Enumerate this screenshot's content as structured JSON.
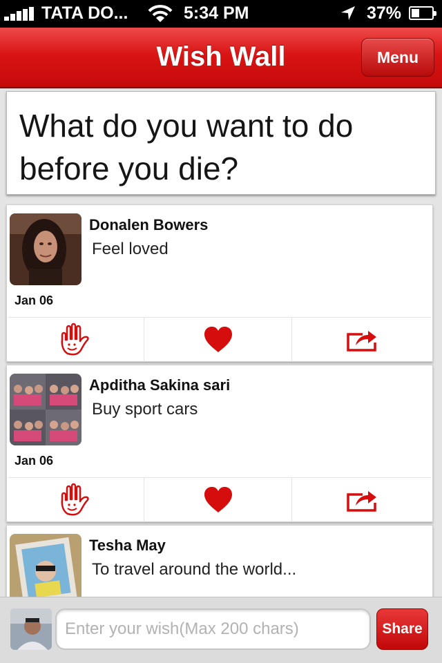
{
  "status_bar": {
    "carrier": "TATA DO...",
    "time": "5:34 PM",
    "battery": "37%"
  },
  "nav": {
    "title": "Wish Wall",
    "menu_label": "Menu"
  },
  "question": "What do you want to do before you die?",
  "wishes": [
    {
      "name": "Donalen Bowers",
      "wish": "Feel loved",
      "date": "Jan 06"
    },
    {
      "name": "Apditha Sakina sari",
      "wish": "Buy sport cars",
      "date": "Jan 06"
    },
    {
      "name": "Tesha May",
      "wish": "To travel around the world...",
      "date": ""
    }
  ],
  "compose": {
    "placeholder": "Enter your wish(Max 200 chars)",
    "share_label": "Share"
  },
  "icons": {
    "high_five": "hand-icon",
    "like": "heart-icon",
    "share": "share-icon"
  },
  "colors": {
    "brand_red": "#d41212",
    "icon_red": "#d50d0d"
  }
}
